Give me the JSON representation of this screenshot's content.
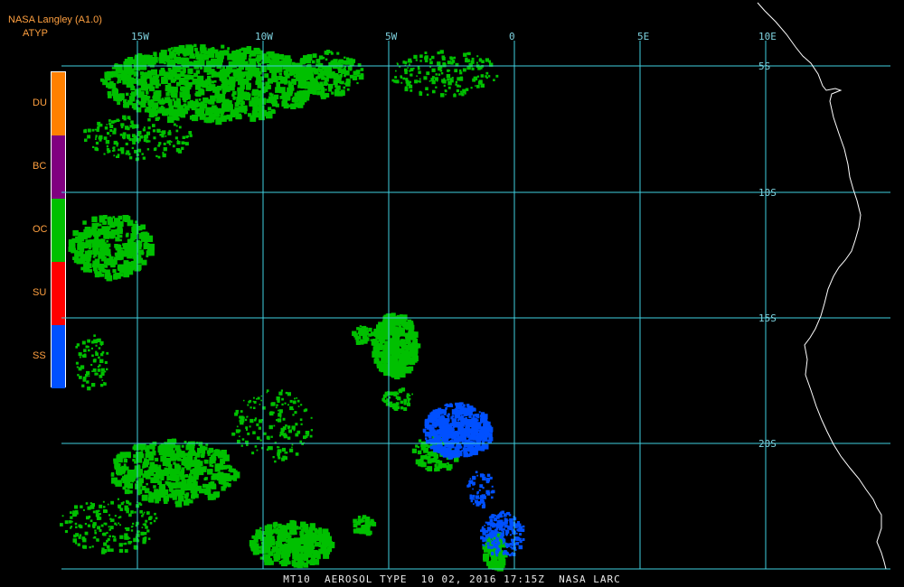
{
  "header": {
    "title": "NASA Langley (A1.0)",
    "product": "ATYP"
  },
  "legend": {
    "items": [
      {
        "label": "DU",
        "color": "#ff8000"
      },
      {
        "label": "BC",
        "color": "#800080"
      },
      {
        "label": "OC",
        "color": "#00c000"
      },
      {
        "label": "SU",
        "color": "#ff0000"
      },
      {
        "label": "SS",
        "color": "#0050ff"
      }
    ]
  },
  "map": {
    "lon_labels": [
      "15W",
      "10W",
      "5W",
      "0",
      "5E",
      "10E"
    ],
    "lat_labels": [
      "5S",
      "10S",
      "15S",
      "20S"
    ],
    "grid_color": "#40d0e0",
    "coast_color": "#ffffff",
    "background": "#000000"
  },
  "footer": {
    "text": "MT10  AEROSOL TYPE  10 02, 2016 17:15Z  NASA LARC"
  }
}
